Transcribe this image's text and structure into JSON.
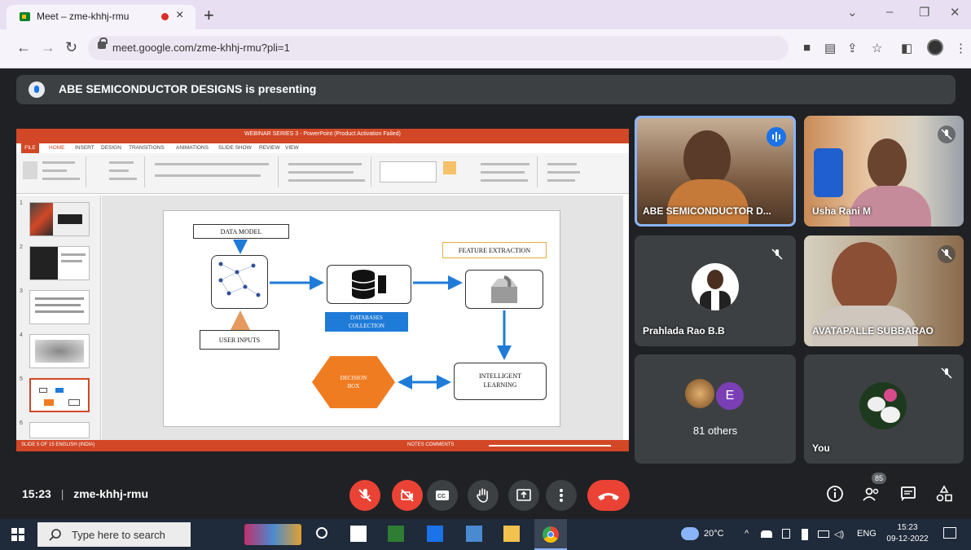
{
  "browser": {
    "tab_title": "Meet – zme-khhj-rmu",
    "tab_close": "×",
    "new_tab": "+",
    "url": "meet.google.com/zme-khhj-rmu?pli=1",
    "window_buttons": [
      "⌄",
      "–",
      "❐",
      "✕"
    ]
  },
  "banner": {
    "text": "ABE SEMICONDUCTOR DESIGNS is presenting"
  },
  "ppt": {
    "title": "WEBINAR SERIES 3 - PowerPoint (Product Activation Failed)",
    "menu": [
      "FILE",
      "HOME",
      "INSERT",
      "DESIGN",
      "TRANSITIONS",
      "ANIMATIONS",
      "SLIDE SHOW",
      "REVIEW",
      "VIEW"
    ],
    "slide_numbers": [
      "1",
      "2",
      "3",
      "4",
      "5",
      "6"
    ],
    "status_left": "SLIDE 5 OF 15   ENGLISH (INDIA)",
    "status_right": "NOTES   COMMENTS"
  },
  "diagram": {
    "data_model": "DATA MODEL",
    "feature_extraction": "FEATURE EXTRACTION",
    "databases_collection": "DATABASES\nCOLLECTION",
    "user_inputs": "USER INPUTS",
    "decision_box": "DECISION\nBOX",
    "intelligent_learning": "INTELLIGENT\nLEARNING"
  },
  "participants": {
    "presenter": "ABE SEMICONDUCTOR D...",
    "usha": "Usha Rani M",
    "prahlada": "Prahlada Rao B.B",
    "avatapalle": "AVATAPALLE SUBBARAO",
    "others_avatar": "E",
    "others": "81 others",
    "you": "You",
    "people_count": "85"
  },
  "meeting": {
    "time": "15:23",
    "separator": "|",
    "code": "zme-khhj-rmu"
  },
  "taskbar": {
    "search_placeholder": "Type here to search",
    "weather": "20°C",
    "lang": "ENG",
    "clock_time": "15:23",
    "clock_date": "09-12-2022"
  },
  "colors": {
    "meet_bg": "#202124",
    "tile_bg": "#3c4043",
    "end_call_red": "#ea4335",
    "ppt_orange": "#d24726",
    "diagram_blue": "#1f7bd8",
    "decision_orange": "#f07c22"
  }
}
